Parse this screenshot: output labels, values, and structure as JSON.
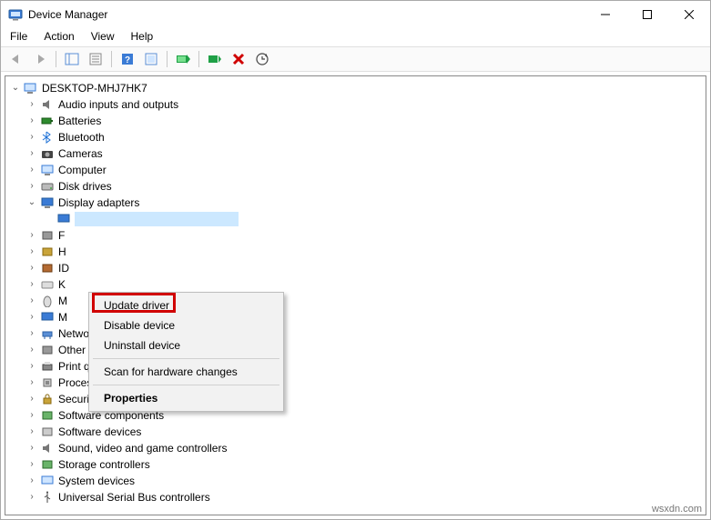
{
  "window": {
    "title": "Device Manager"
  },
  "menubar": {
    "file": "File",
    "action": "Action",
    "view": "View",
    "help": "Help"
  },
  "tree": {
    "root": "DESKTOP-MHJ7HK7",
    "items": [
      "Audio inputs and outputs",
      "Batteries",
      "Bluetooth",
      "Cameras",
      "Computer",
      "Disk drives",
      "Display adapters",
      "F",
      "H",
      "ID",
      "K",
      "M",
      "M",
      "Network adapters",
      "Other devices",
      "Print queues",
      "Processors",
      "Security devices",
      "Software components",
      "Software devices",
      "Sound, video and game controllers",
      "Storage controllers",
      "System devices",
      "Universal Serial Bus controllers"
    ]
  },
  "context_menu": {
    "update": "Update driver",
    "disable": "Disable device",
    "uninstall": "Uninstall device",
    "scan": "Scan for hardware changes",
    "properties": "Properties"
  },
  "watermark": "wsxdn.com"
}
